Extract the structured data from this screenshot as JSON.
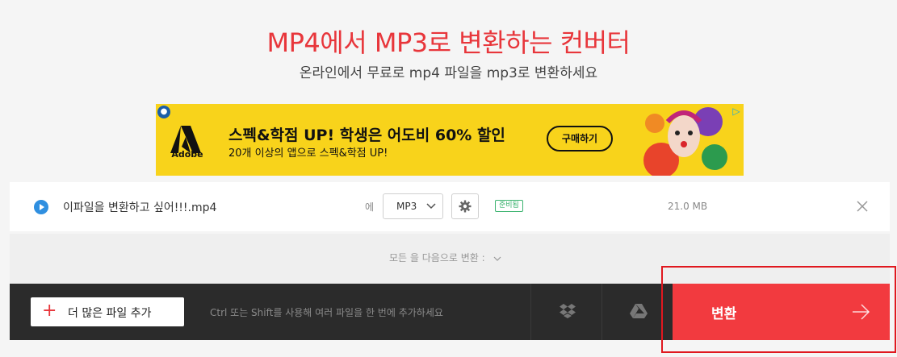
{
  "header": {
    "title": "MP4에서 MP3로 변환하는 컨버터",
    "subtitle": "온라인에서 무료로 mp4 파일을 mp3로 변환하세요"
  },
  "ad": {
    "logo_text": "Adobe",
    "headline": "스펙&학점 UP! 학생은 어도비 60% 할인",
    "subtext": "20개 이상의 앱으로 스펙&학점 UP!",
    "cta_label": "구매하기"
  },
  "file": {
    "name": "이파일을 변환하고 싶어!!!.mp4",
    "to_label": "에",
    "format": "MP3",
    "status": "준비됨",
    "size": "21.0 MB"
  },
  "convert_all": {
    "label": "모든 을 다음으로 변환 :"
  },
  "bottom_bar": {
    "add_more_label": "더 많은 파일 추가",
    "hint": "Ctrl 또는 Shift를 사용해 여러 파일을 한 번에 추가하세요",
    "convert_label": "변환"
  },
  "colors": {
    "accent": "#e8363b",
    "convert_button": "#f23a3f",
    "ad_background": "#f8d31b",
    "ready_badge": "#3bb36f",
    "highlight": "#e0181f"
  },
  "icons": {
    "play": "play-icon",
    "settings": "gear-icon",
    "remove": "close-icon",
    "dropbox": "dropbox-icon",
    "google_drive": "google-drive-icon",
    "arrow": "arrow-right-icon"
  }
}
